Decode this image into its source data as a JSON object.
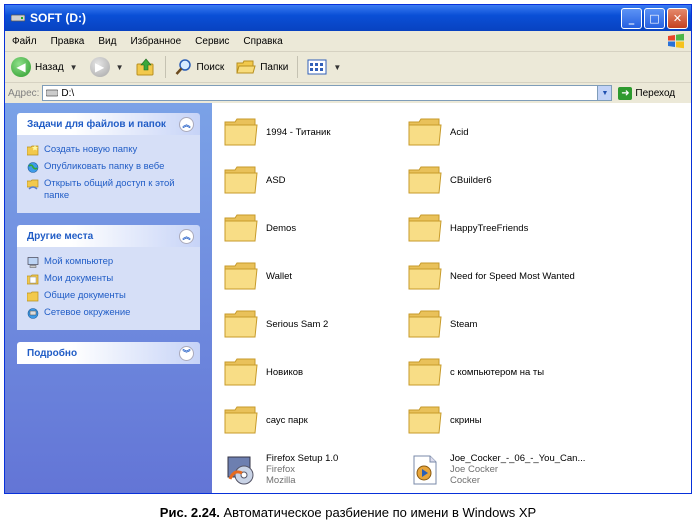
{
  "window": {
    "title": "SOFT (D:)",
    "controls": [
      "_",
      "□",
      "✕"
    ]
  },
  "menu": [
    "Файл",
    "Правка",
    "Вид",
    "Избранное",
    "Сервис",
    "Справка"
  ],
  "toolbar": {
    "back_label": "Назад",
    "search_label": "Поиск",
    "folders_label": "Папки"
  },
  "address": {
    "label": "Адрес:",
    "value": "D:\\",
    "go_label": "Переход"
  },
  "tasks_panel": {
    "title": "Задачи для файлов и папок",
    "items": [
      {
        "label": "Создать новую папку",
        "icon": "new-folder-icon"
      },
      {
        "label": "Опубликовать папку в вебе",
        "icon": "publish-web-icon"
      },
      {
        "label": "Открыть общий доступ к этой папке",
        "icon": "share-folder-icon"
      }
    ]
  },
  "places_panel": {
    "title": "Другие места",
    "items": [
      {
        "label": "Мой компьютер",
        "icon": "my-computer-icon"
      },
      {
        "label": "Мои документы",
        "icon": "my-documents-icon"
      },
      {
        "label": "Общие документы",
        "icon": "shared-documents-icon"
      },
      {
        "label": "Сетевое окружение",
        "icon": "network-places-icon"
      }
    ]
  },
  "details_panel": {
    "title": "Подробно"
  },
  "files": [
    {
      "name": "1994 - Титаник",
      "type": "folder"
    },
    {
      "name": "Acid",
      "type": "folder"
    },
    {
      "name": "ASD",
      "type": "folder"
    },
    {
      "name": "CBuilder6",
      "type": "folder"
    },
    {
      "name": "Demos",
      "type": "folder"
    },
    {
      "name": "HappyTreeFriends",
      "type": "folder"
    },
    {
      "name": "Wallet",
      "type": "folder"
    },
    {
      "name": "Need for Speed Most Wanted",
      "type": "folder"
    },
    {
      "name": "Serious Sam 2",
      "type": "folder"
    },
    {
      "name": "Steam",
      "type": "folder"
    },
    {
      "name": "Новиков",
      "type": "folder"
    },
    {
      "name": "с компьютером на ты",
      "type": "folder"
    },
    {
      "name": "саус парк",
      "type": "folder"
    },
    {
      "name": "скрины",
      "type": "folder"
    },
    {
      "name": "Firefox Setup 1.0",
      "type": "installer",
      "line2": "Firefox",
      "line3": "Mozilla"
    },
    {
      "name": "Joe_Cocker_-_06_-_You_Can...",
      "type": "audio",
      "line2": "Joe Cocker",
      "line3": "Cocker"
    }
  ],
  "caption": {
    "bold": "Рис. 2.24.",
    "text": " Автоматическое разбиение по имени в Windows XP"
  },
  "colors": {
    "titlebar": "#0a4fd6",
    "taskpane": "#6f8fdf",
    "folder": "#f5d67a"
  }
}
